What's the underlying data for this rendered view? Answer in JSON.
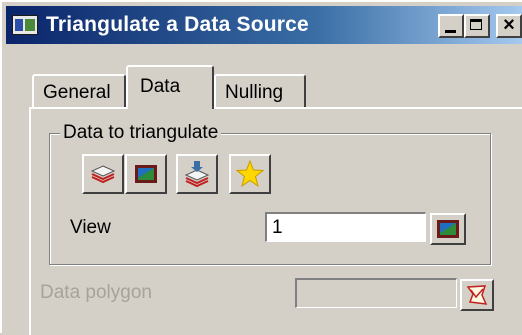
{
  "window": {
    "title": "Triangulate a Data Source",
    "controls": {
      "minimize": "_",
      "maximize": "□",
      "close": "×"
    }
  },
  "tabs": [
    {
      "label": "General",
      "selected": false
    },
    {
      "label": "Data",
      "selected": true
    },
    {
      "label": "Nulling",
      "selected": false
    }
  ],
  "data_group": {
    "label": "Data to triangulate",
    "buttons": [
      {
        "icon": "layers-icon"
      },
      {
        "icon": "view-icon"
      },
      {
        "icon": "model-stack-icon"
      },
      {
        "icon": "star-icon"
      }
    ]
  },
  "view_field": {
    "label": "View",
    "value": "1",
    "pick_icon": "view-pick-icon"
  },
  "polygon_field": {
    "label": "Data polygon",
    "value": "",
    "enabled": false,
    "pick_icon": "polygon-select-icon"
  },
  "colors": {
    "title_bar_start": "#0a246a",
    "title_bar_end": "#a6caf0",
    "face": "#d4d0c8",
    "disabled_text": "#a6a39b"
  }
}
